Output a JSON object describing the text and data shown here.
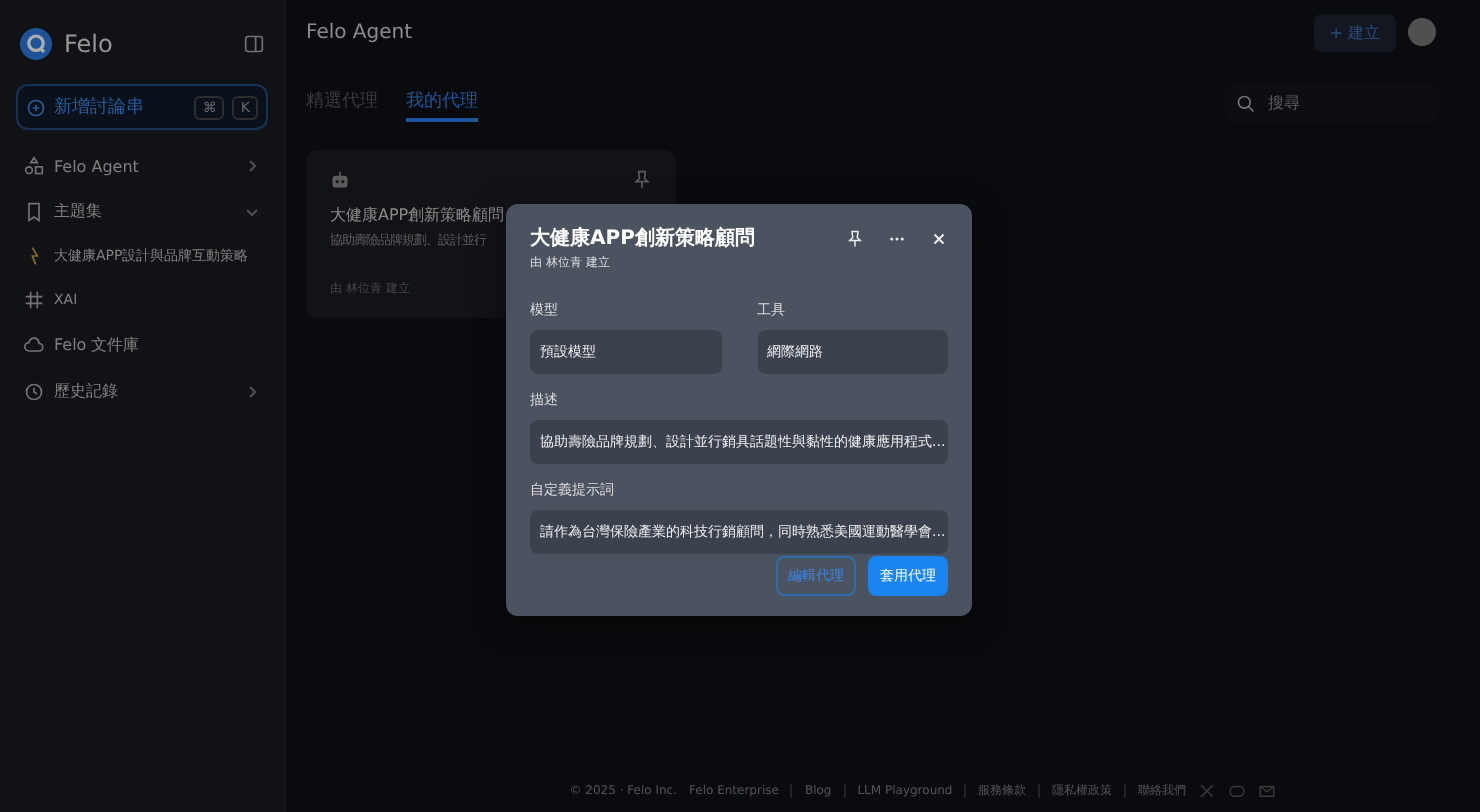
{
  "sidebar": {
    "brand": "Felo",
    "new_button": {
      "label": "新增討論串",
      "keys": [
        "⌘",
        "K"
      ]
    },
    "items": [
      {
        "kind": "agent",
        "label": "Felo Agent",
        "expanded": false
      },
      {
        "kind": "bookmark",
        "label": "主題集",
        "expanded": true,
        "children": [
          {
            "kind": "spark",
            "label": "大健康APP設計與品牌互動策略"
          },
          {
            "kind": "hash",
            "label": "XAI"
          }
        ]
      },
      {
        "kind": "cloud",
        "label": "Felo 文件庫"
      },
      {
        "kind": "history",
        "label": "歷史記錄",
        "expanded": false
      }
    ]
  },
  "header": {
    "title": "Felo Agent",
    "create_button": "+ 建立"
  },
  "tabs": [
    {
      "label": "精選代理",
      "selected": false
    },
    {
      "label": "我的代理",
      "selected": true
    }
  ],
  "search": {
    "placeholder": "搜尋"
  },
  "card": {
    "title": "大健康APP創新策略顧問",
    "description": "協助壽險品牌規劃、設計並行",
    "author": "由 林位青 建立"
  },
  "dialog": {
    "title": "大健康APP創新策略顧問",
    "author": "由 林位青 建立",
    "fields": [
      {
        "label": "模型",
        "value": "預設模型"
      },
      {
        "label": "工具",
        "value": "網際網路"
      },
      {
        "label": "描述",
        "value": "協助壽險品牌規劃、設計並行銷具話題性與黏性的健康應用程式..."
      },
      {
        "label": "自定義提示詞",
        "value": "請作為台灣保險產業的科技行銷顧問，同時熟悉美國運動醫學會..."
      }
    ],
    "buttons": [
      {
        "label": "編輯代理",
        "kind": "secondary"
      },
      {
        "label": "套用代理",
        "kind": "primary"
      }
    ]
  },
  "footer": {
    "links": [
      "© 2025 · Felo Inc.",
      "Felo Enterprise",
      "Blog",
      "LLM Playground",
      "服務條款",
      "隱私權政策",
      "聯絡我們"
    ]
  }
}
